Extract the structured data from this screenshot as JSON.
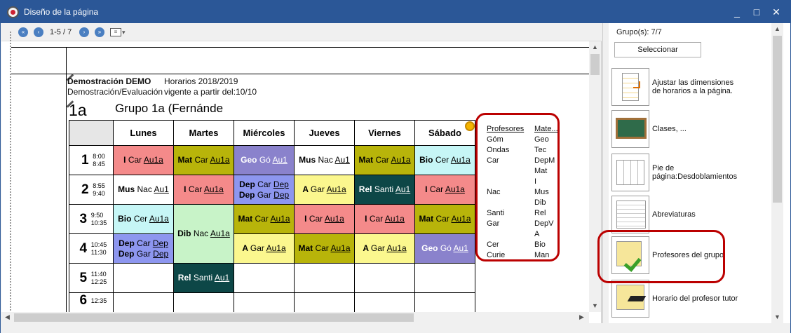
{
  "window": {
    "title": "Diseño de la página",
    "controls": {
      "minimize": "_",
      "maximize": "□",
      "close": "✕"
    }
  },
  "toolbar": {
    "page_label": "1-5 / 7",
    "nav": [
      "first",
      "prev",
      "next",
      "last"
    ]
  },
  "document": {
    "school": "Demostración  DEMO",
    "school_sub": "Demostración/Evaluación",
    "year": "Horarios 2018/2019",
    "valid_from": "vigente a partir del:10/10",
    "group_code": "1a",
    "group_name": "Grupo 1a (Fernánde"
  },
  "timetable": {
    "days": [
      "Lunes",
      "Martes",
      "Miércoles",
      "Jueves",
      "Viernes",
      "Sábado"
    ],
    "periods": [
      {
        "n": "1",
        "start": "8:00",
        "end": "8:45"
      },
      {
        "n": "2",
        "start": "8:55",
        "end": "9:40"
      },
      {
        "n": "3",
        "start": "9:50",
        "end": "10:35"
      },
      {
        "n": "4",
        "start": "10:45",
        "end": "11:30"
      },
      {
        "n": "5",
        "start": "11:40",
        "end": "12:25"
      },
      {
        "n": "6",
        "start": "12:35",
        "end": ""
      }
    ],
    "cells": {
      "p1": [
        {
          "s": "I",
          "t": "Car",
          "r": "Au1a",
          "bg": "#f48a8a"
        },
        {
          "s": "Mat",
          "t": "Car",
          "r": "Au1a",
          "bg": "#b8b40a"
        },
        {
          "s": "Geo",
          "t": "Gó",
          "r": "Au1",
          "bg": "#8a82cc",
          "fg": "#fff"
        },
        {
          "s": "Mus",
          "t": "Nac",
          "r": "Au1",
          "bg": "#ffffff"
        },
        {
          "s": "Mat",
          "t": "Car",
          "r": "Au1a",
          "bg": "#b8b40a"
        },
        {
          "s": "Bio",
          "t": "Cer",
          "r": "Au1a",
          "bg": "#c6f6f6"
        }
      ],
      "p2": [
        {
          "s": "Mus",
          "t": "Nac",
          "r": "Au1",
          "bg": "#ffffff"
        },
        {
          "s": "I",
          "t": "Car",
          "r": "Au1a",
          "bg": "#f48a8a"
        },
        {
          "s": "Dep",
          "t": "Car",
          "r": "Dep",
          "s2": "Dep",
          "t2": "Gar",
          "r2": "Dep",
          "bg": "#8d96ef"
        },
        {
          "s": "A",
          "t": "Gar",
          "r": "Au1a",
          "bg": "#fbf78e"
        },
        {
          "s": "Rel",
          "t": "Santi",
          "r": "Au1",
          "bg": "#0d4747",
          "fg": "#fff"
        },
        {
          "s": "I",
          "t": "Car",
          "r": "Au1a",
          "bg": "#f48a8a"
        }
      ],
      "p3": [
        {
          "s": "Bio",
          "t": "Cer",
          "r": "Au1a",
          "bg": "#c6f6f6"
        },
        {
          "s": "Dib",
          "t": "Nac",
          "r": "Au1a",
          "bg": "#c8f3c8"
        },
        {
          "s": "Mat",
          "t": "Car",
          "r": "Au1a",
          "bg": "#b8b40a"
        },
        {
          "s": "I",
          "t": "Car",
          "r": "Au1a",
          "bg": "#f48a8a"
        },
        {
          "s": "I",
          "t": "Car",
          "r": "Au1a",
          "bg": "#f48a8a"
        },
        {
          "s": "Mat",
          "t": "Car",
          "r": "Au1a",
          "bg": "#b8b40a"
        }
      ],
      "p4": [
        {
          "s": "Dep",
          "t": "Car",
          "r": "Dep",
          "s2": "Dep",
          "t2": "Gar",
          "r2": "Dep",
          "bg": "#8d96ef"
        },
        {
          "s": "A",
          "t": "Gar",
          "r": "Au1a",
          "bg": "#fbf78e"
        },
        {
          "s": "Mat",
          "t": "Car",
          "r": "Au1a",
          "bg": "#b8b40a"
        },
        {
          "s": "A",
          "t": "Gar",
          "r": "Au1a",
          "bg": "#fbf78e"
        },
        {
          "s": "Geo",
          "t": "Gó",
          "r": "Au1",
          "bg": "#8a82cc",
          "fg": "#fff"
        }
      ],
      "p5": [
        {
          "s": "Rel",
          "t": "Santi",
          "r": "Au1",
          "bg": "#0d4747",
          "fg": "#fff"
        }
      ]
    }
  },
  "legend": {
    "col1_title": "Profesores",
    "col2_title": "Mate...",
    "rows": [
      [
        "Góm",
        "Geo"
      ],
      [
        "Ondas",
        "Tec"
      ],
      [
        "Car",
        "DepM"
      ],
      [
        "",
        "Mat"
      ],
      [
        "",
        "I"
      ],
      [
        "Nac",
        "Mus"
      ],
      [
        "",
        "Dib"
      ],
      [
        "Santi",
        "Rel"
      ],
      [
        "Gar",
        "DepV"
      ],
      [
        "",
        "A"
      ],
      [
        "Cer",
        "Bio"
      ],
      [
        "Curie",
        "Man"
      ]
    ]
  },
  "sidebar": {
    "group_count": "Grupo(s): 7/7",
    "select_label": "Seleccionar",
    "items": [
      {
        "label": "Ajustar las dimensiones\nde horarios a la página."
      },
      {
        "label": "Clases, ..."
      },
      {
        "label": "Pie de\npágina:Desdoblamientos"
      },
      {
        "label": "Abreviaturas"
      },
      {
        "label": "Profesores del grupo"
      },
      {
        "label": "Horario del profesor tutor"
      }
    ]
  }
}
